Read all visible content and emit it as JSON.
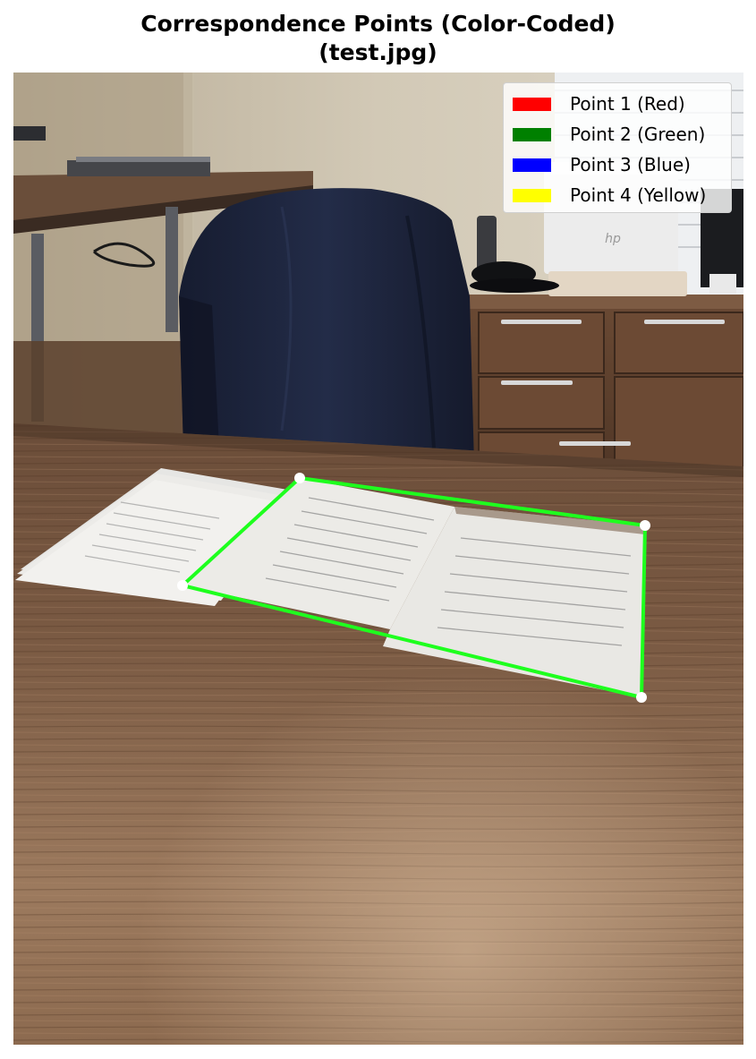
{
  "figure": {
    "title_line1": "Correspondence Points (Color-Coded)",
    "title_line2": "(test.jpg)"
  },
  "legend": {
    "items": [
      {
        "label": "Point 1 (Red)",
        "color": "#ff0000"
      },
      {
        "label": "Point 2 (Green)",
        "color": "#008000"
      },
      {
        "label": "Point 3 (Blue)",
        "color": "#0000ff"
      },
      {
        "label": "Point 4 (Yellow)",
        "color": "#ffff00"
      }
    ]
  },
  "overlay": {
    "outline_color": "#1eff1e",
    "point_marker_color": "#ffffff"
  },
  "photo": {
    "monitor_logo": "hp"
  }
}
